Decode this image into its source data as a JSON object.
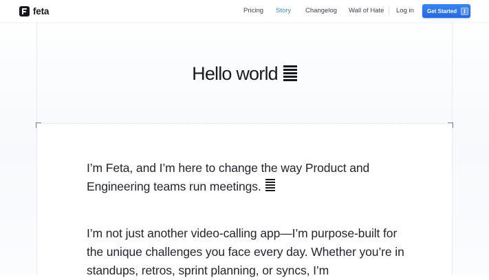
{
  "header": {
    "brand": "feta",
    "nav": [
      {
        "label": "Pricing",
        "active": false
      },
      {
        "label": "Story",
        "active": true
      },
      {
        "label": "Changelog",
        "active": false
      },
      {
        "label": "Wall of Hate",
        "active": false
      }
    ],
    "login_label": "Log in",
    "cta_label": "Get Started",
    "cta_shortcut": "J"
  },
  "hero": {
    "title": "Hello world",
    "emoji_icon": "feta-bars-icon"
  },
  "body": {
    "paragraph_1": "I’m Feta, and I’m here to change the way Product and Engineering teams run meetings.",
    "paragraph_2": "I’m not just another video-calling app—I’m purpose-built for the unique challenges you face every day. Whether you’re in standups, retros, sprint planning, or syncs, I’m"
  },
  "colors": {
    "accent": "#2b73e8",
    "active_nav": "#3a8fd9",
    "text": "#1b1d24"
  }
}
